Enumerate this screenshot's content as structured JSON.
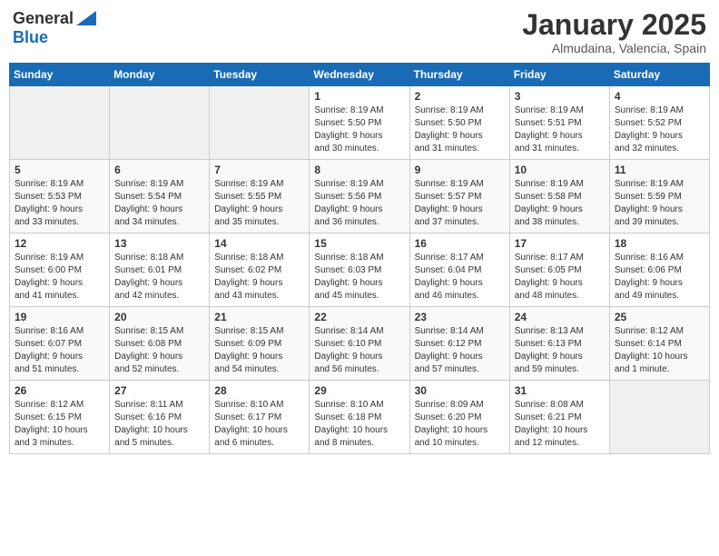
{
  "header": {
    "logo_general": "General",
    "logo_blue": "Blue",
    "month": "January 2025",
    "location": "Almudaina, Valencia, Spain"
  },
  "weekdays": [
    "Sunday",
    "Monday",
    "Tuesday",
    "Wednesday",
    "Thursday",
    "Friday",
    "Saturday"
  ],
  "weeks": [
    [
      {
        "day": "",
        "info": ""
      },
      {
        "day": "",
        "info": ""
      },
      {
        "day": "",
        "info": ""
      },
      {
        "day": "1",
        "info": "Sunrise: 8:19 AM\nSunset: 5:50 PM\nDaylight: 9 hours\nand 30 minutes."
      },
      {
        "day": "2",
        "info": "Sunrise: 8:19 AM\nSunset: 5:50 PM\nDaylight: 9 hours\nand 31 minutes."
      },
      {
        "day": "3",
        "info": "Sunrise: 8:19 AM\nSunset: 5:51 PM\nDaylight: 9 hours\nand 31 minutes."
      },
      {
        "day": "4",
        "info": "Sunrise: 8:19 AM\nSunset: 5:52 PM\nDaylight: 9 hours\nand 32 minutes."
      }
    ],
    [
      {
        "day": "5",
        "info": "Sunrise: 8:19 AM\nSunset: 5:53 PM\nDaylight: 9 hours\nand 33 minutes."
      },
      {
        "day": "6",
        "info": "Sunrise: 8:19 AM\nSunset: 5:54 PM\nDaylight: 9 hours\nand 34 minutes."
      },
      {
        "day": "7",
        "info": "Sunrise: 8:19 AM\nSunset: 5:55 PM\nDaylight: 9 hours\nand 35 minutes."
      },
      {
        "day": "8",
        "info": "Sunrise: 8:19 AM\nSunset: 5:56 PM\nDaylight: 9 hours\nand 36 minutes."
      },
      {
        "day": "9",
        "info": "Sunrise: 8:19 AM\nSunset: 5:57 PM\nDaylight: 9 hours\nand 37 minutes."
      },
      {
        "day": "10",
        "info": "Sunrise: 8:19 AM\nSunset: 5:58 PM\nDaylight: 9 hours\nand 38 minutes."
      },
      {
        "day": "11",
        "info": "Sunrise: 8:19 AM\nSunset: 5:59 PM\nDaylight: 9 hours\nand 39 minutes."
      }
    ],
    [
      {
        "day": "12",
        "info": "Sunrise: 8:19 AM\nSunset: 6:00 PM\nDaylight: 9 hours\nand 41 minutes."
      },
      {
        "day": "13",
        "info": "Sunrise: 8:18 AM\nSunset: 6:01 PM\nDaylight: 9 hours\nand 42 minutes."
      },
      {
        "day": "14",
        "info": "Sunrise: 8:18 AM\nSunset: 6:02 PM\nDaylight: 9 hours\nand 43 minutes."
      },
      {
        "day": "15",
        "info": "Sunrise: 8:18 AM\nSunset: 6:03 PM\nDaylight: 9 hours\nand 45 minutes."
      },
      {
        "day": "16",
        "info": "Sunrise: 8:17 AM\nSunset: 6:04 PM\nDaylight: 9 hours\nand 46 minutes."
      },
      {
        "day": "17",
        "info": "Sunrise: 8:17 AM\nSunset: 6:05 PM\nDaylight: 9 hours\nand 48 minutes."
      },
      {
        "day": "18",
        "info": "Sunrise: 8:16 AM\nSunset: 6:06 PM\nDaylight: 9 hours\nand 49 minutes."
      }
    ],
    [
      {
        "day": "19",
        "info": "Sunrise: 8:16 AM\nSunset: 6:07 PM\nDaylight: 9 hours\nand 51 minutes."
      },
      {
        "day": "20",
        "info": "Sunrise: 8:15 AM\nSunset: 6:08 PM\nDaylight: 9 hours\nand 52 minutes."
      },
      {
        "day": "21",
        "info": "Sunrise: 8:15 AM\nSunset: 6:09 PM\nDaylight: 9 hours\nand 54 minutes."
      },
      {
        "day": "22",
        "info": "Sunrise: 8:14 AM\nSunset: 6:10 PM\nDaylight: 9 hours\nand 56 minutes."
      },
      {
        "day": "23",
        "info": "Sunrise: 8:14 AM\nSunset: 6:12 PM\nDaylight: 9 hours\nand 57 minutes."
      },
      {
        "day": "24",
        "info": "Sunrise: 8:13 AM\nSunset: 6:13 PM\nDaylight: 9 hours\nand 59 minutes."
      },
      {
        "day": "25",
        "info": "Sunrise: 8:12 AM\nSunset: 6:14 PM\nDaylight: 10 hours\nand 1 minute."
      }
    ],
    [
      {
        "day": "26",
        "info": "Sunrise: 8:12 AM\nSunset: 6:15 PM\nDaylight: 10 hours\nand 3 minutes."
      },
      {
        "day": "27",
        "info": "Sunrise: 8:11 AM\nSunset: 6:16 PM\nDaylight: 10 hours\nand 5 minutes."
      },
      {
        "day": "28",
        "info": "Sunrise: 8:10 AM\nSunset: 6:17 PM\nDaylight: 10 hours\nand 6 minutes."
      },
      {
        "day": "29",
        "info": "Sunrise: 8:10 AM\nSunset: 6:18 PM\nDaylight: 10 hours\nand 8 minutes."
      },
      {
        "day": "30",
        "info": "Sunrise: 8:09 AM\nSunset: 6:20 PM\nDaylight: 10 hours\nand 10 minutes."
      },
      {
        "day": "31",
        "info": "Sunrise: 8:08 AM\nSunset: 6:21 PM\nDaylight: 10 hours\nand 12 minutes."
      },
      {
        "day": "",
        "info": ""
      }
    ]
  ]
}
